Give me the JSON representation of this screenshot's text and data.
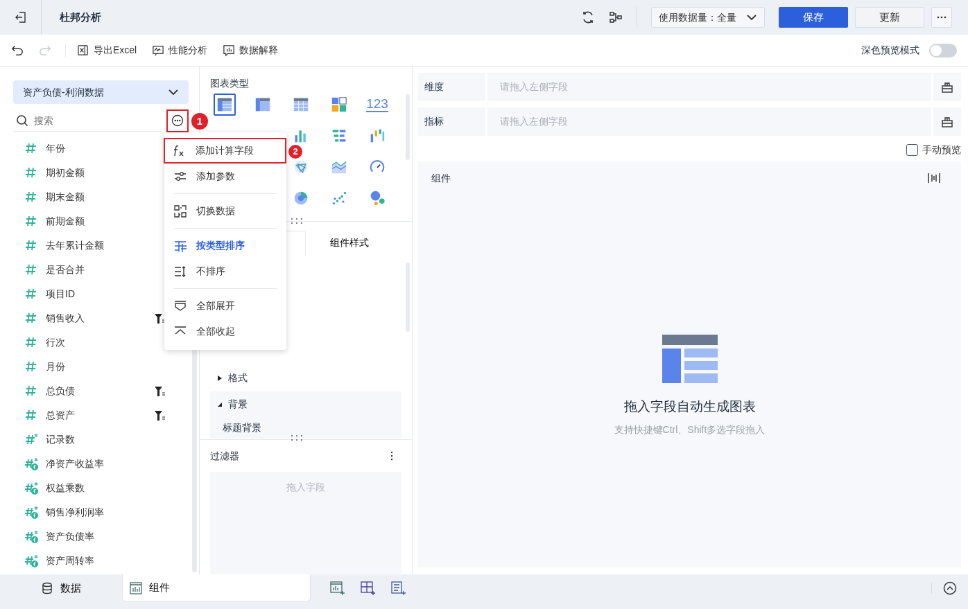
{
  "header": {
    "title": "杜邦分析",
    "data_scope": "使用数据量：全量",
    "buttons": [
      {
        "label": "保存",
        "kind": "primary"
      },
      {
        "label": "更新",
        "kind": "secondary"
      }
    ]
  },
  "toolbar": {
    "history": [
      {
        "kind": "undo",
        "disabled": false
      },
      {
        "kind": "redo",
        "disabled": true
      }
    ],
    "actions": [
      {
        "label": "导出Excel",
        "kind": "excel"
      },
      {
        "label": "性能分析",
        "kind": "perf"
      },
      {
        "label": "数据解释",
        "kind": "explain"
      }
    ],
    "dark_preview": {
      "label": "深色预览模式",
      "on": false
    }
  },
  "data_panel": {
    "dataset": "资产负债-利润数据",
    "search_placeholder": "搜索",
    "more_callout": "1",
    "fields": [
      {
        "label": "年份",
        "kind": "number",
        "filtered": false
      },
      {
        "label": "期初金额",
        "kind": "number",
        "filtered": false
      },
      {
        "label": "期末金额",
        "kind": "number",
        "filtered": false
      },
      {
        "label": "前期金额",
        "kind": "number",
        "filtered": false
      },
      {
        "label": "去年累计金额",
        "kind": "number",
        "filtered": false
      },
      {
        "label": "是否合并",
        "kind": "number",
        "filtered": false
      },
      {
        "label": "项目ID",
        "kind": "number",
        "filtered": false
      },
      {
        "label": "销售收入",
        "kind": "number",
        "filtered": true
      },
      {
        "label": "行次",
        "kind": "number",
        "filtered": false
      },
      {
        "label": "月份",
        "kind": "number",
        "filtered": false
      },
      {
        "label": "总负债",
        "kind": "number",
        "filtered": true
      },
      {
        "label": "总资产",
        "kind": "number",
        "filtered": true
      },
      {
        "label": "记录数",
        "kind": "count",
        "filtered": false
      },
      {
        "label": "净资产收益率",
        "kind": "calc",
        "filtered": false
      },
      {
        "label": "权益乘数",
        "kind": "calc",
        "filtered": false
      },
      {
        "label": "销售净利润率",
        "kind": "calc",
        "filtered": false
      },
      {
        "label": "资产负债率",
        "kind": "calc",
        "filtered": false
      },
      {
        "label": "资产周转率",
        "kind": "calc",
        "filtered": false
      }
    ]
  },
  "menu": {
    "groups": [
      [
        {
          "label": "添加计算字段",
          "kind": "fx",
          "selected": false,
          "callout": "2"
        },
        {
          "label": "添加参数",
          "kind": "param",
          "selected": false
        }
      ],
      [
        {
          "label": "切换数据",
          "kind": "switch",
          "selected": false
        }
      ],
      [
        {
          "label": "按类型排序",
          "kind": "sort-type",
          "selected": true
        },
        {
          "label": "不排序",
          "kind": "no-sort",
          "selected": false
        }
      ],
      [
        {
          "label": "全部展开",
          "kind": "expand",
          "selected": false
        },
        {
          "label": "全部收起",
          "kind": "collapse",
          "selected": false
        }
      ]
    ]
  },
  "chart_types": {
    "title": "图表类型",
    "rows": [
      [
        {
          "kind": "table",
          "selected": true
        },
        {
          "kind": "cross",
          "selected": false
        },
        {
          "kind": "detail",
          "selected": false
        },
        {
          "kind": "blocks",
          "selected": false
        },
        {
          "kind": "number",
          "label": "123",
          "selected": false
        }
      ],
      [
        {
          "kind": "bars",
          "selected": false
        },
        {
          "kind": "hbar",
          "selected": false
        },
        {
          "kind": "waterfall",
          "selected": false
        }
      ],
      [
        {
          "kind": "radar",
          "selected": false
        },
        {
          "kind": "area",
          "selected": false
        },
        {
          "kind": "gauge",
          "selected": false
        }
      ],
      [
        {
          "kind": "pie",
          "selected": false
        },
        {
          "kind": "scatter",
          "selected": false
        },
        {
          "kind": "bubble",
          "selected": false
        }
      ]
    ]
  },
  "style_tabs": [
    {
      "label": "组件样式",
      "selected": false
    }
  ],
  "format_sections": [
    {
      "label": "格式",
      "expanded": false
    },
    {
      "label": "背景",
      "expanded": true,
      "children": [
        {
          "label": "标题背景"
        }
      ]
    }
  ],
  "filter": {
    "title": "过滤器",
    "placeholder": "拖入字段"
  },
  "config": {
    "rows": [
      {
        "label": "维度",
        "placeholder": "请拖入左侧字段"
      },
      {
        "label": "指标",
        "placeholder": "请拖入左侧字段"
      }
    ],
    "manual_preview": {
      "label": "手动预览",
      "checked": false
    }
  },
  "canvas": {
    "title": "组件",
    "empty_title": "拖入字段自动生成图表",
    "empty_hint": "支持快捷键Ctrl、Shift多选字段拖入"
  },
  "bottom_tabs": [
    {
      "label": "数据",
      "kind": "data",
      "selected": false
    },
    {
      "label": "组件",
      "kind": "widget",
      "selected": true
    }
  ]
}
